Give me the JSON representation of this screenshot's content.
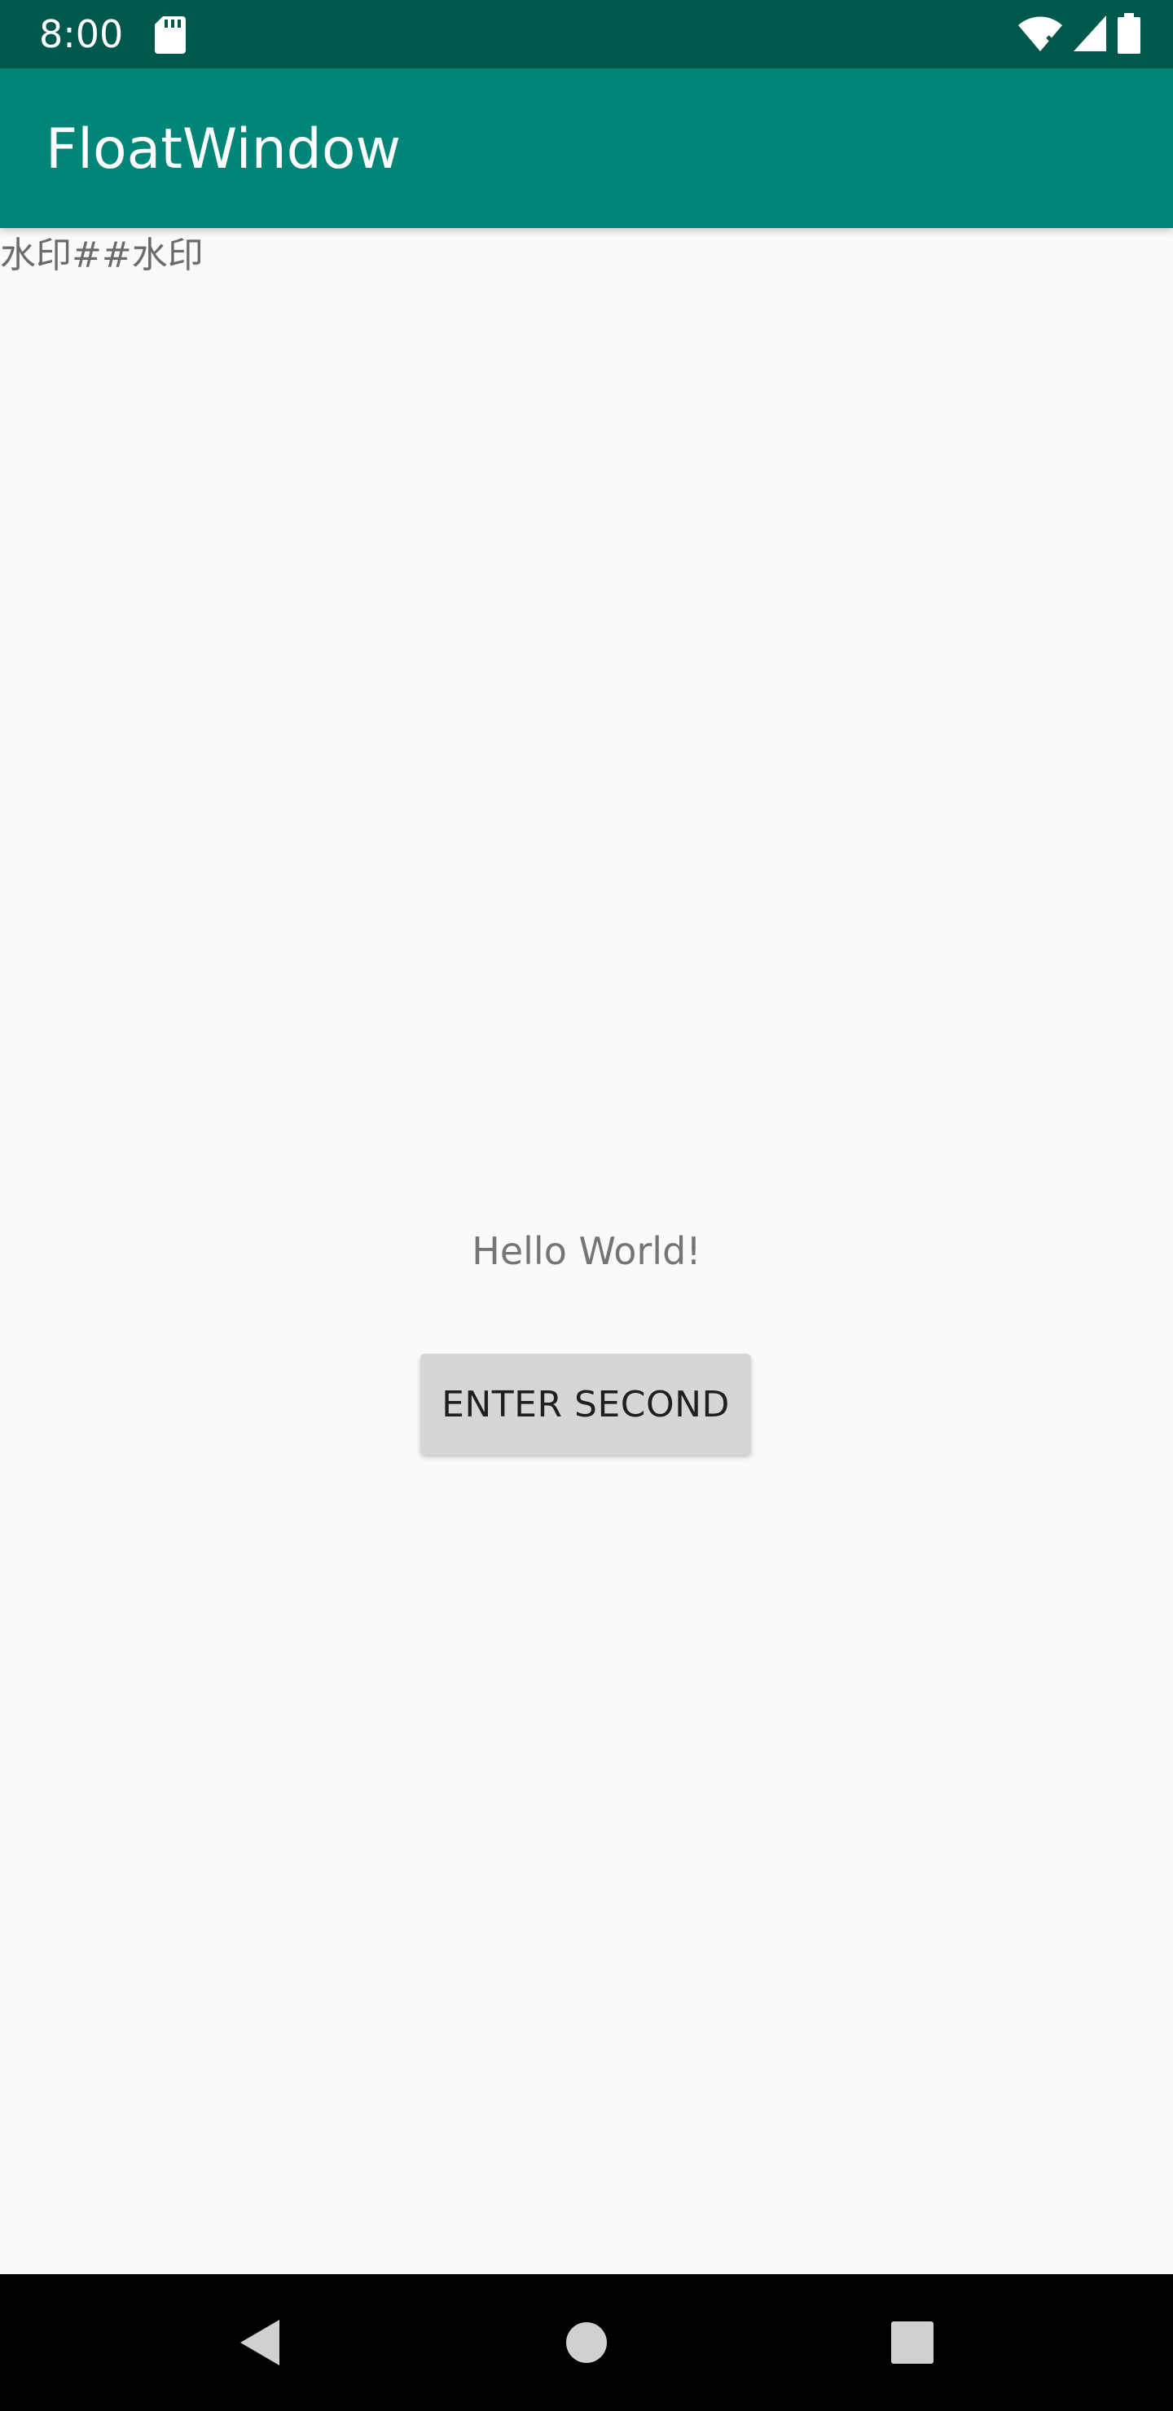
{
  "status_bar": {
    "time": "8:00",
    "icons": [
      "sd-card-icon",
      "wifi-icon",
      "cell-signal-icon",
      "battery-icon"
    ],
    "background": "#00574b"
  },
  "app_bar": {
    "title": "FloatWindow",
    "background": "#008577"
  },
  "watermark": {
    "text": "水印##水印"
  },
  "main": {
    "hello_text": "Hello World!",
    "enter_second_label": "ENTER SECOND"
  },
  "nav_bar": {
    "buttons": [
      "back-icon",
      "home-icon",
      "recents-icon"
    ]
  }
}
